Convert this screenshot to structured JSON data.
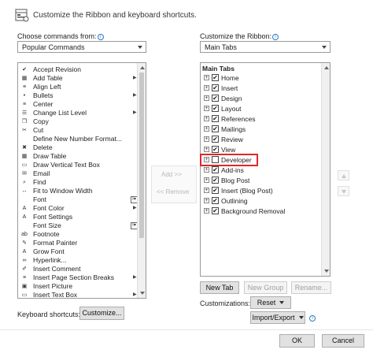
{
  "header": {
    "title": "Customize the Ribbon and keyboard shortcuts."
  },
  "left": {
    "label": "Choose commands from:",
    "selected": "Popular Commands",
    "commands": [
      {
        "label": "Accept Revision",
        "icon": "accept-revision-icon",
        "glyph": "✔",
        "extra": ""
      },
      {
        "label": "Add Table",
        "icon": "table-icon",
        "glyph": "▦",
        "extra": "chevron"
      },
      {
        "label": "Align Left",
        "icon": "align-left-icon",
        "glyph": "≡",
        "extra": ""
      },
      {
        "label": "Bullets",
        "icon": "bullets-icon",
        "glyph": "•",
        "extra": "split"
      },
      {
        "label": "Center",
        "icon": "align-center-icon",
        "glyph": "≡",
        "extra": ""
      },
      {
        "label": "Change List Level",
        "icon": "list-level-icon",
        "glyph": "☰",
        "extra": "chevron"
      },
      {
        "label": "Copy",
        "icon": "copy-icon",
        "glyph": "❐",
        "extra": ""
      },
      {
        "label": "Cut",
        "icon": "scissors-icon",
        "glyph": "✂",
        "extra": ""
      },
      {
        "label": "Define New Number Format...",
        "icon": "none",
        "glyph": "",
        "extra": ""
      },
      {
        "label": "Delete",
        "icon": "delete-icon",
        "glyph": "✖",
        "extra": ""
      },
      {
        "label": "Draw Table",
        "icon": "draw-table-icon",
        "glyph": "▦",
        "extra": ""
      },
      {
        "label": "Draw Vertical Text Box",
        "icon": "text-box-icon",
        "glyph": "▭",
        "extra": ""
      },
      {
        "label": "Email",
        "icon": "email-icon",
        "glyph": "✉",
        "extra": ""
      },
      {
        "label": "Find",
        "icon": "search-icon",
        "glyph": "⌕",
        "extra": ""
      },
      {
        "label": "Fit to Window Width",
        "icon": "fit-width-icon",
        "glyph": "↔",
        "extra": ""
      },
      {
        "label": "Font",
        "icon": "none",
        "glyph": "",
        "extra": "font-box"
      },
      {
        "label": "Font Color",
        "icon": "font-color-icon",
        "glyph": "A",
        "extra": "split"
      },
      {
        "label": "Font Settings",
        "icon": "font-settings-icon",
        "glyph": "A",
        "extra": ""
      },
      {
        "label": "Font Size",
        "icon": "none",
        "glyph": "",
        "extra": "font-box"
      },
      {
        "label": "Footnote",
        "icon": "footnote-icon",
        "glyph": "ab",
        "extra": ""
      },
      {
        "label": "Format Painter",
        "icon": "format-painter-icon",
        "glyph": "✎",
        "extra": ""
      },
      {
        "label": "Grow Font",
        "icon": "grow-font-icon",
        "glyph": "A",
        "extra": ""
      },
      {
        "label": "Hyperlink...",
        "icon": "hyperlink-icon",
        "glyph": "∞",
        "extra": ""
      },
      {
        "label": "Insert Comment",
        "icon": "comment-icon",
        "glyph": "✐",
        "extra": ""
      },
      {
        "label": "Insert Page  Section Breaks",
        "icon": "page-break-icon",
        "glyph": "≡",
        "extra": "chevron"
      },
      {
        "label": "Insert Picture",
        "icon": "picture-icon",
        "glyph": "▣",
        "extra": ""
      },
      {
        "label": "Insert Text Box",
        "icon": "text-box-icon",
        "glyph": "▭",
        "extra": "chevron"
      }
    ]
  },
  "right": {
    "label": "Customize the Ribbon:",
    "selected": "Main Tabs",
    "group_header": "Main Tabs",
    "tabs": [
      {
        "label": "Home",
        "checked": true
      },
      {
        "label": "Insert",
        "checked": true
      },
      {
        "label": "Design",
        "checked": true
      },
      {
        "label": "Layout",
        "checked": true
      },
      {
        "label": "References",
        "checked": true
      },
      {
        "label": "Mailings",
        "checked": true
      },
      {
        "label": "Review",
        "checked": true
      },
      {
        "label": "View",
        "checked": true
      },
      {
        "label": "Developer",
        "checked": false
      },
      {
        "label": "Add-ins",
        "checked": true
      },
      {
        "label": "Blog Post",
        "checked": true
      },
      {
        "label": "Insert (Blog Post)",
        "checked": true
      },
      {
        "label": "Outlining",
        "checked": true
      },
      {
        "label": "Background Removal",
        "checked": true
      }
    ],
    "buttons": {
      "new_tab": "New Tab",
      "new_group": "New Group",
      "rename": "Rename..."
    },
    "customizations_label": "Customizations:",
    "reset": "Reset",
    "import_export": "Import/Export"
  },
  "bottom": {
    "shortcuts_label": "Keyboard shortcuts:",
    "customize": "Customize...",
    "ok": "OK",
    "cancel": "Cancel"
  },
  "marks": {
    "checkmark": "✔",
    "expand": "+",
    "info": "i",
    "add": "Add >>",
    "remove": "<< Remove"
  },
  "colors": {
    "highlight": "#e0262c",
    "accent": "#2b79c2"
  }
}
